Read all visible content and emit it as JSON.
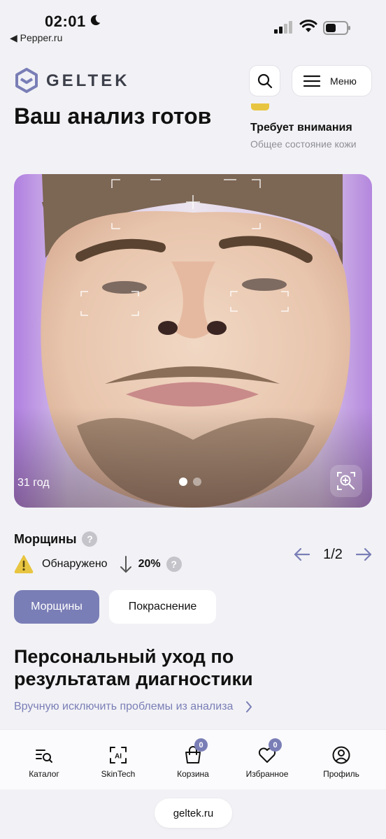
{
  "status_bar": {
    "time": "02:01",
    "back_app": "◀ Pepper.ru"
  },
  "header": {
    "logo_text": "GELTEK",
    "menu_label": "Меню"
  },
  "result": {
    "title": "Ваш анализ готов",
    "status_title": "Требует внимания",
    "status_subtitle": "Общее состояние кожи",
    "status_color": "#e8c541"
  },
  "photo": {
    "age": "31 год",
    "slides": 2,
    "active_slide": 1
  },
  "analysis": {
    "category": "Морщины",
    "detected_label": "Обнаружено",
    "percent": "20%",
    "trend": "down",
    "pager": "1/2"
  },
  "tabs": [
    {
      "label": "Морщины",
      "active": true
    },
    {
      "label": "Покраснение",
      "active": false
    }
  ],
  "care": {
    "title": "Персональный уход по результатам диагностики",
    "exclude_link": "Вручную исключить проблемы из анализа"
  },
  "bottom_nav": [
    {
      "label": "Каталог",
      "icon": "catalog-icon"
    },
    {
      "label": "SkinTech",
      "icon": "ai-scan-icon"
    },
    {
      "label": "Корзина",
      "icon": "cart-icon",
      "badge": "0"
    },
    {
      "label": "Избранное",
      "icon": "heart-icon",
      "badge": "0"
    },
    {
      "label": "Профиль",
      "icon": "profile-icon"
    }
  ],
  "url": "geltek.ru",
  "colors": {
    "accent": "#7a7eb6",
    "warning": "#e8c541",
    "background": "#f2f2f6"
  }
}
